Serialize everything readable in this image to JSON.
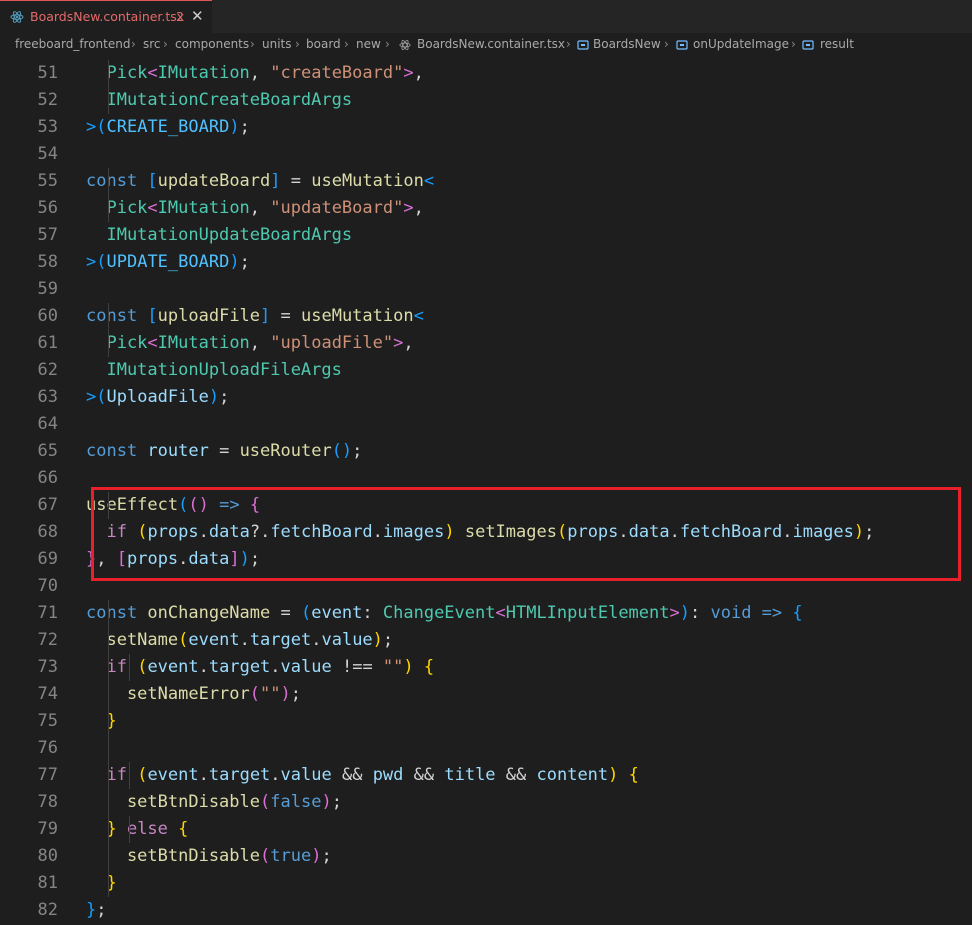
{
  "tab": {
    "filename": "BoardsNew.container.tsx",
    "problems": "2",
    "close": "✕"
  },
  "breadcrumb": [
    "freeboard_frontend",
    "src",
    "components",
    "units",
    "board",
    "new",
    "BoardsNew.container.tsx",
    "BoardsNew",
    "onUpdateImage",
    "result"
  ],
  "line_numbers": [
    "51",
    "52",
    "53",
    "54",
    "55",
    "56",
    "57",
    "58",
    "59",
    "60",
    "61",
    "62",
    "63",
    "64",
    "65",
    "66",
    "67",
    "68",
    "69",
    "70",
    "71",
    "72",
    "73",
    "74",
    "75",
    "76",
    "77",
    "78",
    "79",
    "80",
    "81",
    "82"
  ],
  "colors": {
    "tab_error": "#e46a6a",
    "highlight_box": "#e8202a",
    "background": "#1e1e1e"
  },
  "code": [
    [
      [
        "  Pick",
        "ty"
      ],
      [
        "<",
        "p2"
      ],
      [
        "IMutation",
        "ty"
      ],
      [
        ", ",
        "op"
      ],
      [
        "\"createBoard\"",
        "str"
      ],
      [
        ">",
        "p2"
      ],
      [
        ",",
        "op"
      ]
    ],
    [
      [
        "  IMutationCreateBoardArgs",
        "ty"
      ]
    ],
    [
      [
        ">",
        "p3"
      ],
      [
        "(",
        "p3"
      ],
      [
        "CREATE_BOARD",
        "cst"
      ],
      [
        ")",
        "p3"
      ],
      [
        ";",
        "op"
      ]
    ],
    [],
    [
      [
        "const ",
        "kw"
      ],
      [
        "[",
        "p3"
      ],
      [
        "updateBoard",
        "fn"
      ],
      [
        "]",
        "p3"
      ],
      [
        " = ",
        "op"
      ],
      [
        "useMutation",
        "fn"
      ],
      [
        "<",
        "p3"
      ]
    ],
    [
      [
        "  Pick",
        "ty"
      ],
      [
        "<",
        "p2"
      ],
      [
        "IMutation",
        "ty"
      ],
      [
        ", ",
        "op"
      ],
      [
        "\"updateBoard\"",
        "str"
      ],
      [
        ">",
        "p2"
      ],
      [
        ",",
        "op"
      ]
    ],
    [
      [
        "  IMutationUpdateBoardArgs",
        "ty"
      ]
    ],
    [
      [
        ">",
        "p3"
      ],
      [
        "(",
        "p3"
      ],
      [
        "UPDATE_BOARD",
        "cst"
      ],
      [
        ")",
        "p3"
      ],
      [
        ";",
        "op"
      ]
    ],
    [],
    [
      [
        "const ",
        "kw"
      ],
      [
        "[",
        "p3"
      ],
      [
        "uploadFile",
        "fn"
      ],
      [
        "]",
        "p3"
      ],
      [
        " = ",
        "op"
      ],
      [
        "useMutation",
        "fn"
      ],
      [
        "<",
        "p3"
      ]
    ],
    [
      [
        "  Pick",
        "ty"
      ],
      [
        "<",
        "p2"
      ],
      [
        "IMutation",
        "ty"
      ],
      [
        ", ",
        "op"
      ],
      [
        "\"uploadFile\"",
        "str"
      ],
      [
        ">",
        "p2"
      ],
      [
        ",",
        "op"
      ]
    ],
    [
      [
        "  IMutationUploadFileArgs",
        "ty"
      ]
    ],
    [
      [
        ">",
        "p3"
      ],
      [
        "(",
        "p3"
      ],
      [
        "UploadFile",
        "var"
      ],
      [
        ")",
        "p3"
      ],
      [
        ";",
        "op"
      ]
    ],
    [],
    [
      [
        "const ",
        "kw"
      ],
      [
        "router",
        "var"
      ],
      [
        " = ",
        "op"
      ],
      [
        "useRouter",
        "fn"
      ],
      [
        "()",
        "p3"
      ],
      [
        ";",
        "op"
      ]
    ],
    [],
    [
      [
        "useEffect",
        "fn"
      ],
      [
        "(",
        "p3"
      ],
      [
        "()",
        "p2"
      ],
      [
        " => ",
        "kw"
      ],
      [
        "{",
        "p2"
      ]
    ],
    [
      [
        "  if ",
        "ctl"
      ],
      [
        "(",
        "p1"
      ],
      [
        "props",
        "var"
      ],
      [
        ".",
        "op"
      ],
      [
        "data",
        "var"
      ],
      [
        "?.",
        "op"
      ],
      [
        "fetchBoard",
        "var"
      ],
      [
        ".",
        "op"
      ],
      [
        "images",
        "var"
      ],
      [
        ")",
        "p1"
      ],
      [
        " ",
        "op"
      ],
      [
        "setImages",
        "fn"
      ],
      [
        "(",
        "p1"
      ],
      [
        "props",
        "var"
      ],
      [
        ".",
        "op"
      ],
      [
        "data",
        "var"
      ],
      [
        ".",
        "op"
      ],
      [
        "fetchBoard",
        "var"
      ],
      [
        ".",
        "op"
      ],
      [
        "images",
        "var"
      ],
      [
        ")",
        "p1"
      ],
      [
        ";",
        "op"
      ]
    ],
    [
      [
        "}",
        "p2"
      ],
      [
        ", ",
        "op"
      ],
      [
        "[",
        "p2"
      ],
      [
        "props",
        "var"
      ],
      [
        ".",
        "op"
      ],
      [
        "data",
        "var"
      ],
      [
        "]",
        "p2"
      ],
      [
        ")",
        "p3"
      ],
      [
        ";",
        "op"
      ]
    ],
    [],
    [
      [
        "const ",
        "kw"
      ],
      [
        "onChangeName",
        "fn"
      ],
      [
        " = ",
        "op"
      ],
      [
        "(",
        "p3"
      ],
      [
        "event",
        "var"
      ],
      [
        ": ",
        "op"
      ],
      [
        "ChangeEvent",
        "ty"
      ],
      [
        "<",
        "p2"
      ],
      [
        "HTMLInputElement",
        "ty"
      ],
      [
        ">",
        "p2"
      ],
      [
        ")",
        "p3"
      ],
      [
        ": ",
        "op"
      ],
      [
        "void",
        "kw"
      ],
      [
        " => ",
        "kw"
      ],
      [
        "{",
        "p3"
      ]
    ],
    [
      [
        "  setName",
        "fn"
      ],
      [
        "(",
        "p1"
      ],
      [
        "event",
        "var"
      ],
      [
        ".",
        "op"
      ],
      [
        "target",
        "var"
      ],
      [
        ".",
        "op"
      ],
      [
        "value",
        "var"
      ],
      [
        ")",
        "p1"
      ],
      [
        ";",
        "op"
      ]
    ],
    [
      [
        "  if ",
        "ctl"
      ],
      [
        "(",
        "p1"
      ],
      [
        "event",
        "var"
      ],
      [
        ".",
        "op"
      ],
      [
        "target",
        "var"
      ],
      [
        ".",
        "op"
      ],
      [
        "value",
        "var"
      ],
      [
        " !== ",
        "op"
      ],
      [
        "\"\"",
        "str"
      ],
      [
        ")",
        "p1"
      ],
      [
        " ",
        "op"
      ],
      [
        "{",
        "p1"
      ]
    ],
    [
      [
        "    setNameError",
        "fn"
      ],
      [
        "(",
        "p2"
      ],
      [
        "\"\"",
        "str"
      ],
      [
        ")",
        "p2"
      ],
      [
        ";",
        "op"
      ]
    ],
    [
      [
        "  }",
        "p1"
      ]
    ],
    [],
    [
      [
        "  if ",
        "ctl"
      ],
      [
        "(",
        "p1"
      ],
      [
        "event",
        "var"
      ],
      [
        ".",
        "op"
      ],
      [
        "target",
        "var"
      ],
      [
        ".",
        "op"
      ],
      [
        "value",
        "var"
      ],
      [
        " && ",
        "op"
      ],
      [
        "pwd",
        "var"
      ],
      [
        " && ",
        "op"
      ],
      [
        "title",
        "var"
      ],
      [
        " && ",
        "op"
      ],
      [
        "content",
        "var"
      ],
      [
        ")",
        "p1"
      ],
      [
        " ",
        "op"
      ],
      [
        "{",
        "p1"
      ]
    ],
    [
      [
        "    setBtnDisable",
        "fn"
      ],
      [
        "(",
        "p2"
      ],
      [
        "false",
        "kw"
      ],
      [
        ")",
        "p2"
      ],
      [
        ";",
        "op"
      ]
    ],
    [
      [
        "  }",
        "p1"
      ],
      [
        " else ",
        "ctl"
      ],
      [
        "{",
        "p1"
      ]
    ],
    [
      [
        "    setBtnDisable",
        "fn"
      ],
      [
        "(",
        "p2"
      ],
      [
        "true",
        "kw"
      ],
      [
        ")",
        "p2"
      ],
      [
        ";",
        "op"
      ]
    ],
    [
      [
        "  }",
        "p1"
      ]
    ],
    [
      [
        "}",
        "p3"
      ],
      [
        ";",
        "op"
      ]
    ]
  ]
}
